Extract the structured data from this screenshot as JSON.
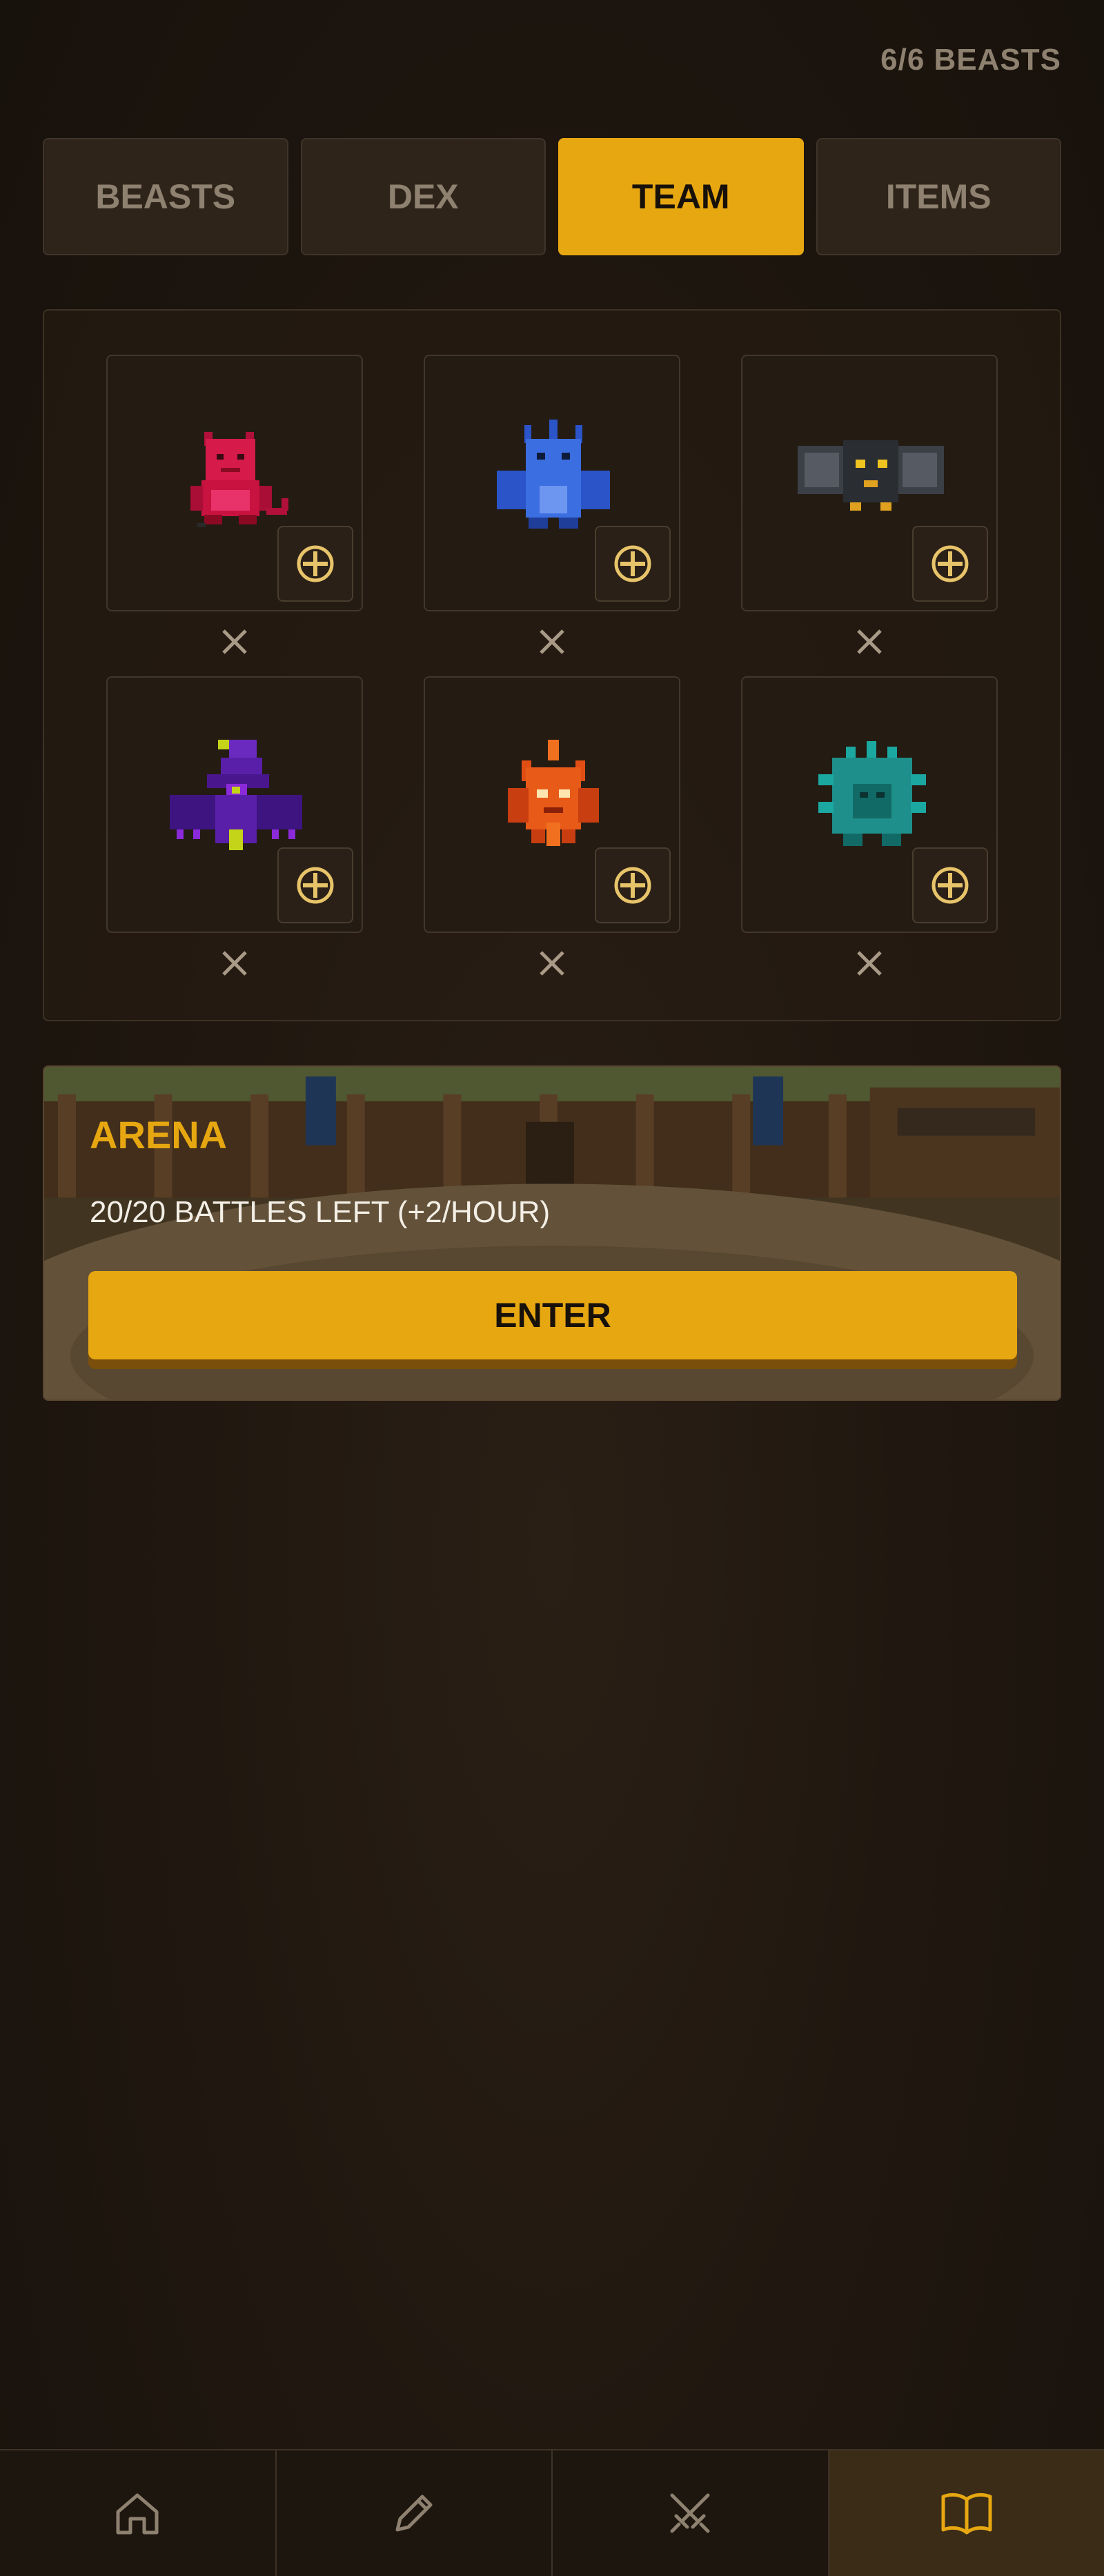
{
  "header": {
    "beast_count": "6/6 BEASTS"
  },
  "tabs": [
    {
      "label": "BEASTS",
      "active": false
    },
    {
      "label": "DEX",
      "active": false
    },
    {
      "label": "TEAM",
      "active": true
    },
    {
      "label": "ITEMS",
      "active": false
    }
  ],
  "team": {
    "slots": [
      {
        "beast_icon": "red-imp-sprite",
        "add_icon": "plus-circle-icon",
        "remove_icon": "close-icon"
      },
      {
        "beast_icon": "blue-dragon-sprite",
        "add_icon": "plus-circle-icon",
        "remove_icon": "close-icon"
      },
      {
        "beast_icon": "black-bat-sprite",
        "add_icon": "plus-circle-icon",
        "remove_icon": "close-icon"
      },
      {
        "beast_icon": "purple-wizard-sprite",
        "add_icon": "plus-circle-icon",
        "remove_icon": "close-icon"
      },
      {
        "beast_icon": "fire-spirit-sprite",
        "add_icon": "plus-circle-icon",
        "remove_icon": "close-icon"
      },
      {
        "beast_icon": "teal-spiked-beast-sprite",
        "add_icon": "plus-circle-icon",
        "remove_icon": "close-icon"
      }
    ]
  },
  "arena": {
    "title": "ARENA",
    "battles_left": "20/20 BATTLES LEFT (+2/HOUR)",
    "enter_label": "ENTER"
  },
  "bottom_nav": [
    {
      "icon": "home-icon",
      "active": false
    },
    {
      "icon": "pencil-icon",
      "active": false
    },
    {
      "icon": "crossed-swords-icon",
      "active": false
    },
    {
      "icon": "open-book-icon",
      "active": true
    }
  ],
  "colors": {
    "accent": "#e7a711",
    "background": "#1e160f",
    "panel_border": "#3e3226",
    "muted_text": "#8e8170"
  }
}
